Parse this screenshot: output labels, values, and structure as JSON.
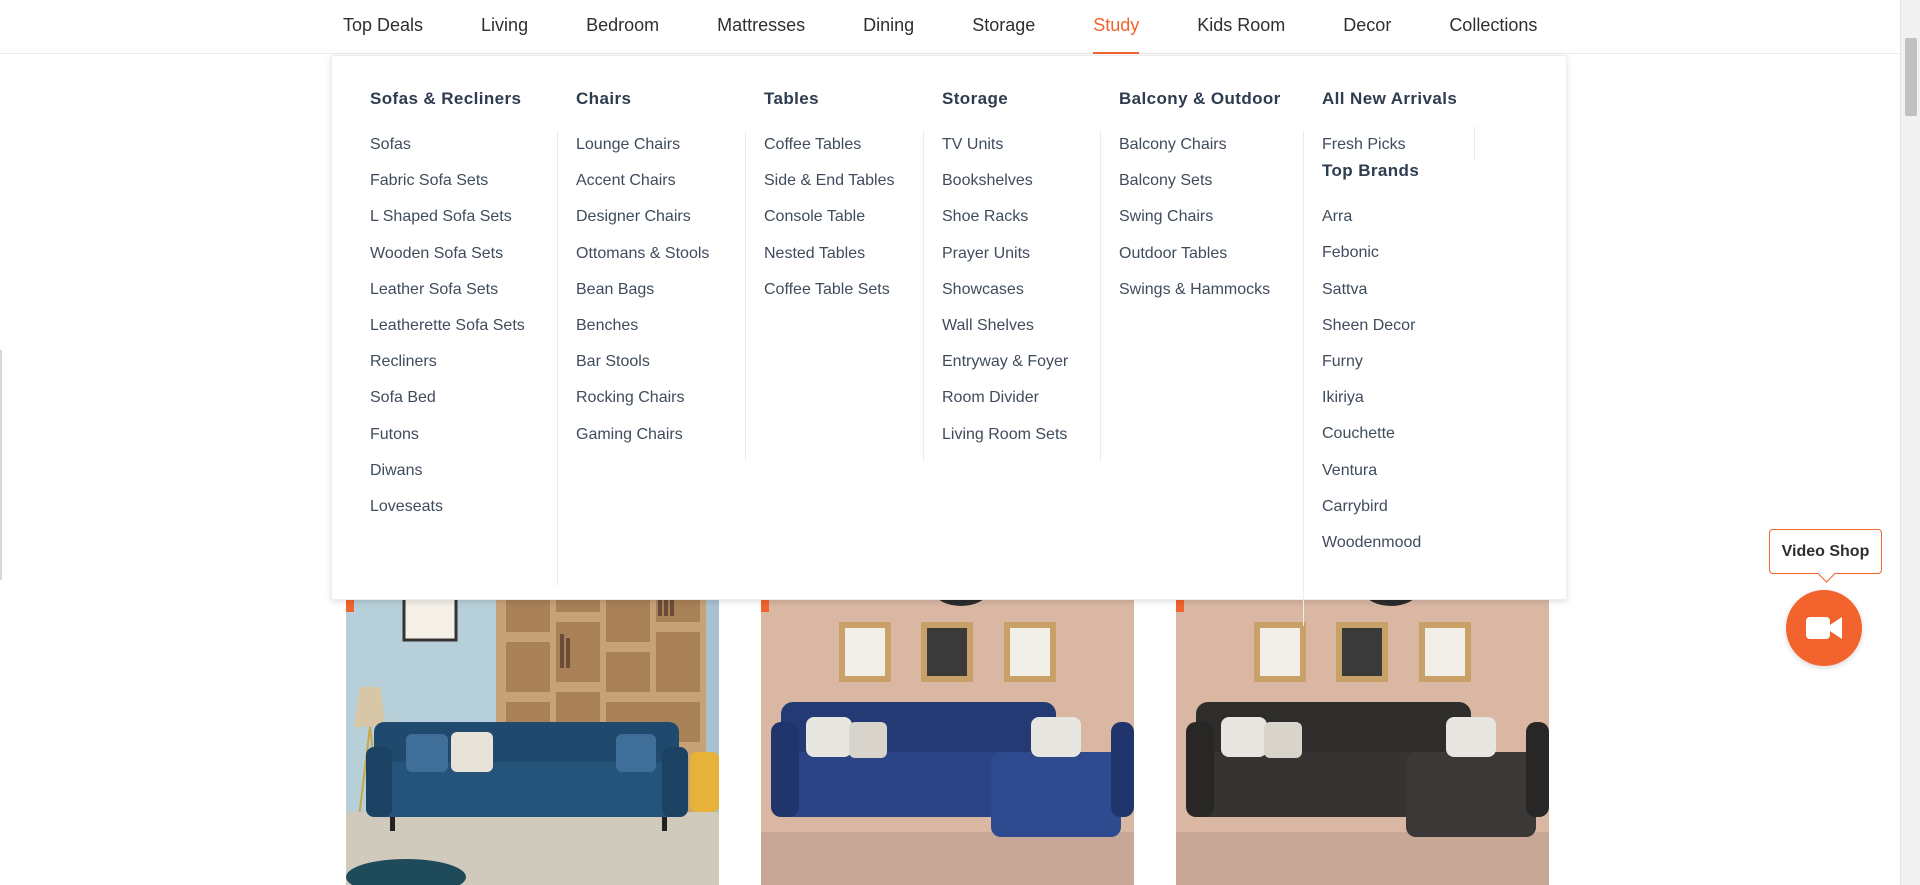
{
  "nav": {
    "items": [
      {
        "label": "Top Deals"
      },
      {
        "label": "Living"
      },
      {
        "label": "Bedroom"
      },
      {
        "label": "Mattresses"
      },
      {
        "label": "Dining"
      },
      {
        "label": "Storage"
      },
      {
        "label": "Study",
        "active": true
      },
      {
        "label": "Kids Room"
      },
      {
        "label": "Decor"
      },
      {
        "label": "Collections"
      }
    ]
  },
  "mega_menu": {
    "columns": [
      {
        "title": "Sofas & Recliners",
        "items": [
          "Sofas",
          "Fabric Sofa Sets",
          "L Shaped Sofa Sets",
          "Wooden Sofa Sets",
          "Leather Sofa Sets",
          "Leatherette Sofa Sets",
          "Recliners",
          "Sofa Bed",
          "Futons",
          "Diwans",
          "Loveseats"
        ]
      },
      {
        "title": "Chairs",
        "items": [
          "Lounge Chairs",
          "Accent Chairs",
          "Designer Chairs",
          "Ottomans & Stools",
          "Bean Bags",
          "Benches",
          "Bar Stools",
          "Rocking Chairs",
          "Gaming Chairs"
        ]
      },
      {
        "title": "Tables",
        "items": [
          "Coffee Tables",
          "Side & End Tables",
          "Console Table",
          "Nested Tables",
          "Coffee Table Sets"
        ]
      },
      {
        "title": "Storage",
        "items": [
          "TV Units",
          "Bookshelves",
          "Shoe Racks",
          "Prayer Units",
          "Showcases",
          "Wall Shelves",
          "Entryway & Foyer",
          "Room Divider",
          "Living Room Sets"
        ]
      },
      {
        "title": "Balcony & Outdoor",
        "items": [
          "Balcony Chairs",
          "Balcony Sets",
          "Swing Chairs",
          "Outdoor Tables",
          "Swings & Hammocks"
        ]
      },
      {
        "title": "All New Arrivals",
        "items": [
          "Fresh Picks"
        ],
        "sub_title": "Top Brands",
        "sub_items": [
          "Arra",
          "Febonic",
          "Sattva",
          "Sheen Decor",
          "Furny",
          "Ikiriya",
          "Couchette",
          "Ventura",
          "Carrybird",
          "Woodenmood"
        ]
      }
    ]
  },
  "video_shop": {
    "label": "Video Shop",
    "icon": "video-camera-icon"
  },
  "cards": [
    {
      "icon": "blue-sofa-with-bookshelf"
    },
    {
      "icon": "blue-sectional-sofa"
    },
    {
      "icon": "black-sectional-sofa"
    }
  ],
  "colors": {
    "accent": "#f2632d",
    "menu_title": "#2e3c4f",
    "menu_item": "#3f4c5c"
  }
}
